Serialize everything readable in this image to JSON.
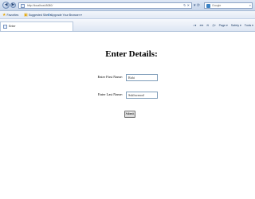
{
  "browser": {
    "address_url": "http://localhost:8080/",
    "search_placeholder": "Google",
    "favorites_label": "Favorites",
    "suggested_sites_label": "Suggested Sites ▾",
    "upgrade_label": "Upgrade Your Browser ▾",
    "tab_title": "Enter",
    "command_bar": [
      "Page ▾",
      "Safety ▾",
      "Tools ▾"
    ]
  },
  "form": {
    "heading": "Enter Details:",
    "first_name_label": "Enter First Name:",
    "first_name_value": "Rahi",
    "last_name_label": "Enter Last Name:",
    "last_name_value": "Sukhwanod",
    "submit_label": "Submit"
  }
}
